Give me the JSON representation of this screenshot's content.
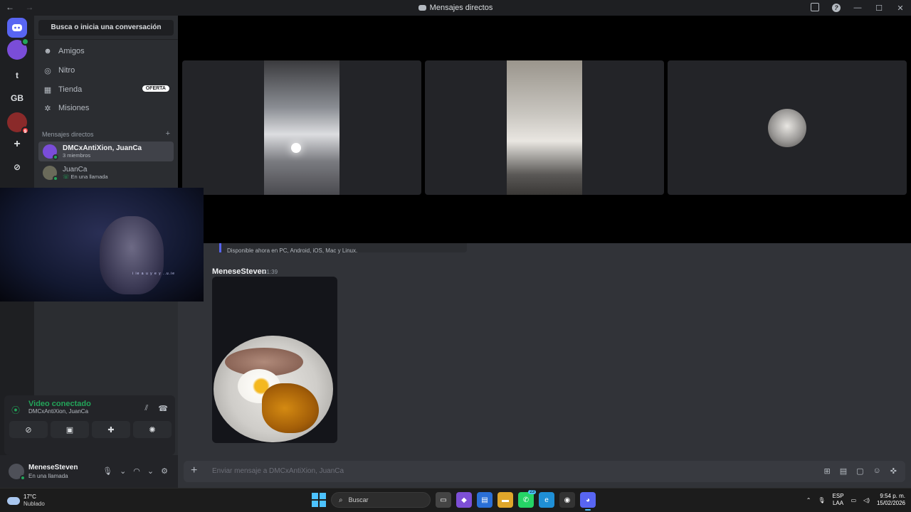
{
  "window": {
    "title": "Mensajes directos",
    "nav_back": "←",
    "nav_forward": "→"
  },
  "guilds": [
    {
      "name": "discord-home",
      "glyph": ""
    },
    {
      "name": "group-dm",
      "glyph": ""
    },
    {
      "name": "server-t",
      "glyph": "t"
    },
    {
      "name": "server-gb",
      "glyph": "GB"
    },
    {
      "name": "server-avatar",
      "glyph": "",
      "badge": "9"
    },
    {
      "name": "add-server",
      "glyph": "+"
    },
    {
      "name": "explore",
      "glyph": "⊘"
    }
  ],
  "sidebar": {
    "search_label": "Busca o inicia una conversación",
    "nav": [
      {
        "label": "Amigos",
        "icon": "friends-icon"
      },
      {
        "label": "Nitro",
        "icon": "nitro-icon"
      },
      {
        "label": "Tienda",
        "icon": "shop-icon",
        "badge": "OFERTA"
      },
      {
        "label": "Misiones",
        "icon": "quests-icon"
      }
    ],
    "dm_header": "Mensajes directos",
    "dm_add": "+",
    "dms": [
      {
        "name": "DMCxAntiXion, JuanCa",
        "sub": "3 miembros",
        "active": true
      },
      {
        "name": "JuanCa",
        "sub": "En una llamada",
        "active": false
      }
    ]
  },
  "voice": {
    "status": "Video conectado",
    "channel": "DMCxAntiXion, JuanCa"
  },
  "user": {
    "name": "MeneseSteven",
    "status": "En una llamada"
  },
  "chat": {
    "embed_tail": "Disponible ahora en PC, Android, iOS, Mac y Linux.",
    "author": "MeneseSteven",
    "time": "21:39",
    "composer_placeholder": "Enviar mensaje a DMCxAntiXion, JuanCa"
  },
  "pip_caption": "i ie a u y e y ..u.ie",
  "taskbar": {
    "temp": "17°C",
    "weather": "Nublado",
    "search": "Buscar",
    "whatsapp_count": "23",
    "lang1": "ESP",
    "lang2": "LAA",
    "time": "9:54 p. m.",
    "date": "15/02/2026"
  },
  "colors": {
    "accent": "#5865f2",
    "online": "#23a55a",
    "background": "#313338",
    "sidebar": "#2b2d31"
  }
}
